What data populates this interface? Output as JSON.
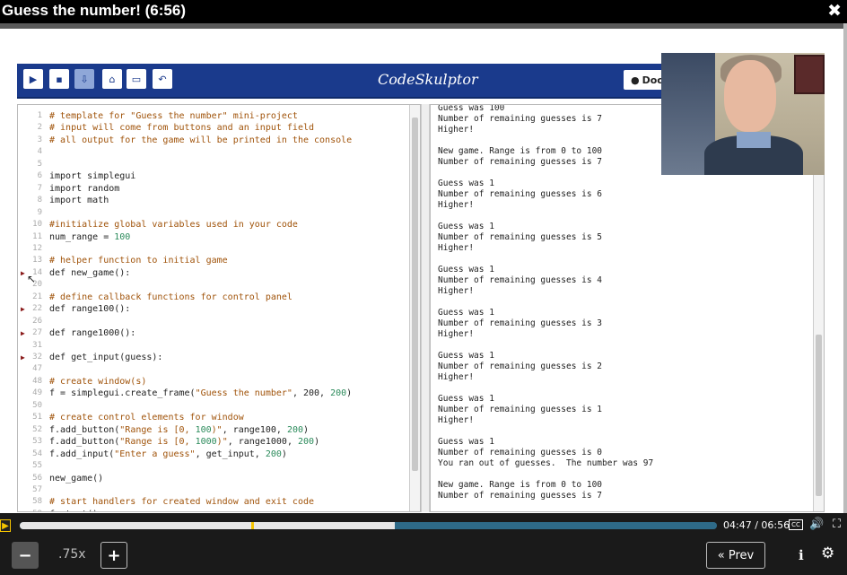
{
  "title_bar": {
    "title": "Guess the number! (6:56)",
    "close_icon": "✖"
  },
  "toolbar": {
    "buttons": [
      {
        "name": "run-icon",
        "glyph": "▶"
      },
      {
        "name": "save-icon",
        "glyph": "▪"
      },
      {
        "name": "download-icon",
        "glyph": "⇩"
      },
      {
        "name": "reset-icon",
        "glyph": "⌂"
      },
      {
        "name": "open-icon",
        "glyph": "▭"
      },
      {
        "name": "undo-icon",
        "glyph": "↶"
      }
    ],
    "title": "CodeSkulptor",
    "docs_label": "Doc"
  },
  "editor": {
    "lines": [
      {
        "n": "1",
        "text": "# template for \"Guess the number\" mini-project",
        "cls": "cm"
      },
      {
        "n": "2",
        "text": "# input will come from buttons and an input field",
        "cls": "cm"
      },
      {
        "n": "3",
        "text": "# all output for the game will be printed in the console",
        "cls": "cm"
      },
      {
        "n": "4",
        "text": "",
        "cls": ""
      },
      {
        "n": "5",
        "text": "",
        "cls": ""
      },
      {
        "n": "6",
        "text": "import simplegui",
        "cls": ""
      },
      {
        "n": "7",
        "text": "import random",
        "cls": ""
      },
      {
        "n": "8",
        "text": "import math",
        "cls": ""
      },
      {
        "n": "9",
        "text": "",
        "cls": ""
      },
      {
        "n": "10",
        "text": "#initialize global variables used in your code",
        "cls": "cm"
      },
      {
        "n": "11",
        "text": "num_range = 100",
        "cls": "",
        "num": "100"
      },
      {
        "n": "12",
        "text": "",
        "cls": ""
      },
      {
        "n": "13",
        "text": "# helper function to initial game",
        "cls": "cm"
      },
      {
        "n": "14",
        "text": "def new_game():",
        "cls": "",
        "fold": true
      },
      {
        "n": "20",
        "text": "",
        "cls": ""
      },
      {
        "n": "21",
        "text": "# define callback functions for control panel",
        "cls": "cm"
      },
      {
        "n": "22",
        "text": "def range100():",
        "cls": "",
        "fold": true
      },
      {
        "n": "26",
        "text": "",
        "cls": ""
      },
      {
        "n": "27",
        "text": "def range1000():",
        "cls": "",
        "fold": true
      },
      {
        "n": "31",
        "text": "",
        "cls": ""
      },
      {
        "n": "32",
        "text": "def get_input(guess):",
        "cls": "",
        "fold": true
      },
      {
        "n": "47",
        "text": "",
        "cls": ""
      },
      {
        "n": "48",
        "text": "# create window(s)",
        "cls": "cm"
      },
      {
        "n": "49",
        "text": "f = simplegui.create_frame(\"Guess the number\", 200, 200)",
        "cls": ""
      },
      {
        "n": "50",
        "text": "",
        "cls": ""
      },
      {
        "n": "51",
        "text": "# create control elements for window",
        "cls": "cm"
      },
      {
        "n": "52",
        "text": "f.add_button(\"Range is [0, 100)\", range100, 200)",
        "cls": ""
      },
      {
        "n": "53",
        "text": "f.add_button(\"Range is [0, 1000)\", range1000, 200)",
        "cls": ""
      },
      {
        "n": "54",
        "text": "f.add_input(\"Enter a guess\", get_input, 200)",
        "cls": ""
      },
      {
        "n": "55",
        "text": "",
        "cls": ""
      },
      {
        "n": "56",
        "text": "new_game()",
        "cls": ""
      },
      {
        "n": "57",
        "text": "",
        "cls": ""
      },
      {
        "n": "58",
        "text": "# start handlers for created window and exit code",
        "cls": "cm"
      },
      {
        "n": "59",
        "text": "f.start()",
        "cls": ""
      }
    ]
  },
  "console": {
    "lines": [
      "Guess was 100",
      "Number of remaining guesses is 7",
      "Higher!",
      "",
      "New game. Range is from 0 to 100",
      "Number of remaining guesses is 7",
      "",
      "Guess was 1",
      "Number of remaining guesses is 6",
      "Higher!",
      "",
      "Guess was 1",
      "Number of remaining guesses is 5",
      "Higher!",
      "",
      "Guess was 1",
      "Number of remaining guesses is 4",
      "Higher!",
      "",
      "Guess was 1",
      "Number of remaining guesses is 3",
      "Higher!",
      "",
      "Guess was 1",
      "Number of remaining guesses is 2",
      "Higher!",
      "",
      "Guess was 1",
      "Number of remaining guesses is 1",
      "Higher!",
      "",
      "Guess was 1",
      "Number of remaining guesses is 0",
      "You ran out of guesses.  The number was 97",
      "",
      "New game. Range is from 0 to 100",
      "Number of remaining guesses is 7"
    ]
  },
  "player": {
    "time": "04:47 / 06:56",
    "progress_fraction": 0.69,
    "buffered_fraction": 1.0,
    "speed": ".75x",
    "minus": "−",
    "plus": "+",
    "prev_label": "« Prev",
    "play_glyph": "▶",
    "cc_label": "CC",
    "volume_glyph": "🔊",
    "fullscreen_glyph": "⛶",
    "info_glyph": "ℹ",
    "gear_glyph": "⚙"
  },
  "colors": {
    "toolbar": "#1a3a8c",
    "comment": "#a0530a",
    "number": "#2a8a5a",
    "accent": "#f5c400"
  }
}
